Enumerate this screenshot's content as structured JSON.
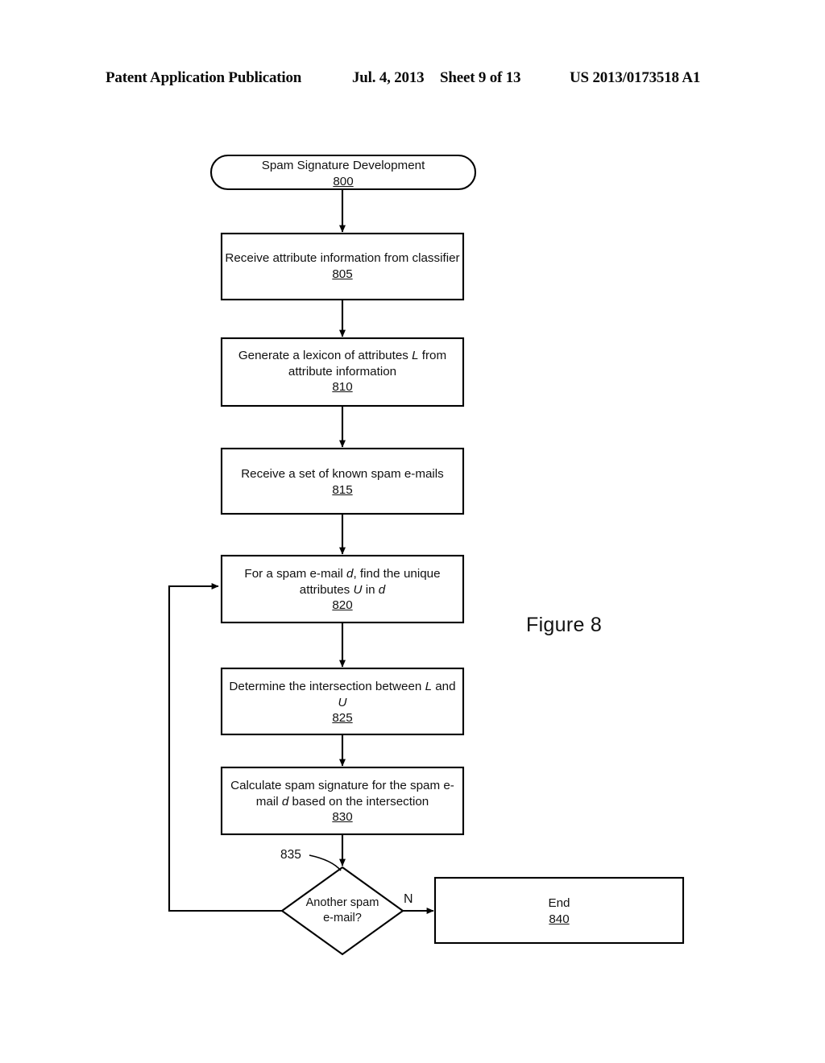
{
  "header": {
    "publication": "Patent Application Publication",
    "date": "Jul. 4, 2013",
    "sheet": "Sheet 9 of 13",
    "publication_number": "US 2013/0173518 A1"
  },
  "figure": {
    "caption": "Figure 8",
    "title": "Spam Signature Development"
  },
  "colors": {
    "ink": "#111111",
    "paper": "#ffffff",
    "line": "#000000"
  },
  "nodes": {
    "start": {
      "shape": "stadium",
      "label": "Spam Signature Development",
      "ref": "800"
    },
    "step_805": {
      "shape": "process",
      "label": "Receive attribute information from classifier",
      "ref": "805"
    },
    "step_810": {
      "shape": "process",
      "line1_pre": "Generate a lexicon of attributes ",
      "line1_italic": "L",
      "line1_post": " from",
      "line2": "attribute information",
      "ref": "810"
    },
    "step_815": {
      "shape": "process",
      "label": "Receive a set of known spam e-mails",
      "ref": "815"
    },
    "step_820": {
      "shape": "process",
      "line1_pre": "For a spam e-mail ",
      "line1_italic": "d",
      "line1_post": ", find the unique",
      "line2_pre": "attributes ",
      "line2_italic1": "U",
      "line2_mid": " in ",
      "line2_italic2": "d",
      "ref": "820"
    },
    "step_825": {
      "shape": "process",
      "line1_pre": "Determine the intersection between ",
      "line1_italic": "L",
      "line1_post": " and",
      "line2_italic": "U",
      "ref": "825"
    },
    "step_830": {
      "shape": "process",
      "line1": "Calculate spam signature for the spam e-",
      "line2_pre": "mail ",
      "line2_italic": "d",
      "line2_post": " based on the intersection",
      "ref": "830"
    },
    "decision_835": {
      "shape": "diamond",
      "line1": "Another spam",
      "line2": "e-mail?",
      "ref": "835"
    },
    "end_840": {
      "shape": "process",
      "label": "End",
      "ref": "840"
    }
  },
  "edges": {
    "no_branch_label": "N",
    "loop_note": "feedback from decision back to step 820"
  }
}
